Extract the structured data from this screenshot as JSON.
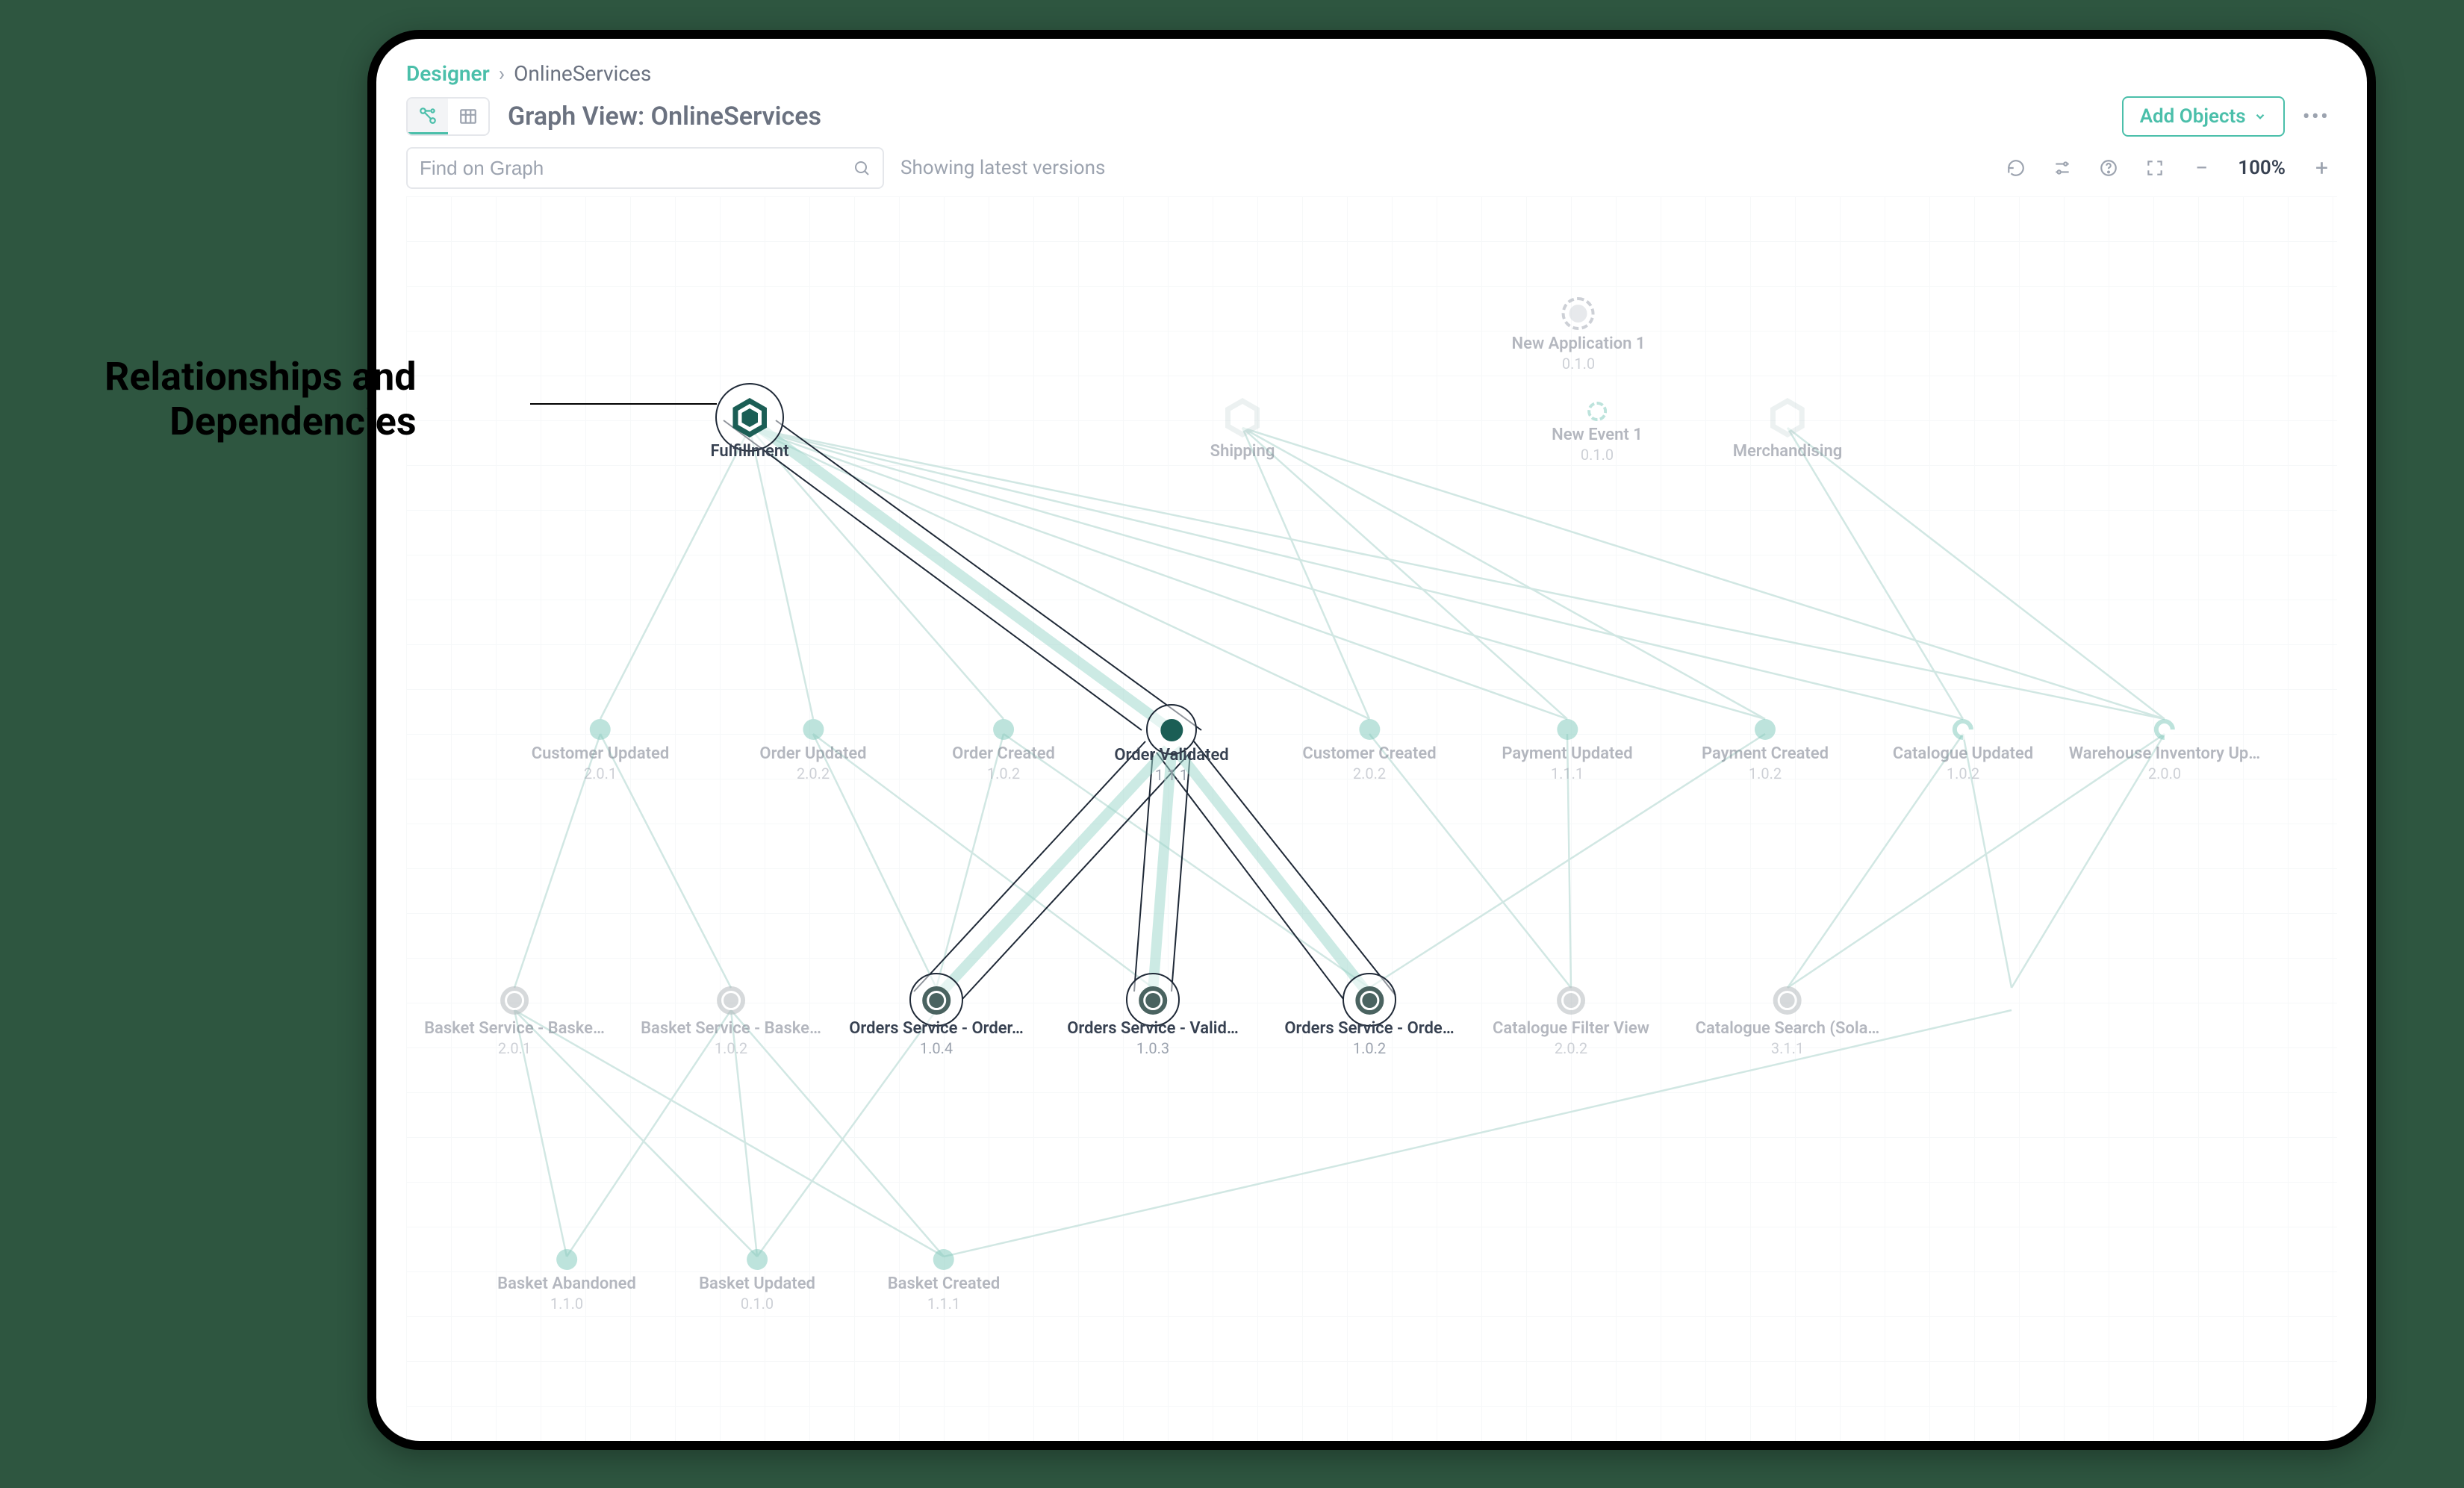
{
  "annotation": {
    "line1": "Relationships and",
    "line2": "Dependencies"
  },
  "breadcrumb": {
    "root": "Designer",
    "current": "OnlineServices"
  },
  "title": "Graph View: OnlineServices",
  "buttons": {
    "add_objects": "Add Objects"
  },
  "search": {
    "placeholder": "Find on Graph"
  },
  "status": "Showing latest versions",
  "zoom": "100%",
  "nodes": {
    "fulfillment": {
      "label": "Fulfillment",
      "version": ""
    },
    "shipping": {
      "label": "Shipping",
      "version": ""
    },
    "merchandising": {
      "label": "Merchandising",
      "version": ""
    },
    "new_app": {
      "label": "New Application 1",
      "version": "0.1.0"
    },
    "new_event": {
      "label": "New Event 1",
      "version": "0.1.0"
    },
    "customer_updated": {
      "label": "Customer Updated",
      "version": "2.0.1"
    },
    "order_updated": {
      "label": "Order Updated",
      "version": "2.0.2"
    },
    "order_created": {
      "label": "Order Created",
      "version": "1.0.2"
    },
    "order_validated": {
      "label": "Order Validated",
      "version": "1.1.1"
    },
    "customer_created": {
      "label": "Customer Created",
      "version": "2.0.2"
    },
    "payment_updated": {
      "label": "Payment Updated",
      "version": "1.1.1"
    },
    "payment_created": {
      "label": "Payment Created",
      "version": "1.0.2"
    },
    "catalogue_updated": {
      "label": "Catalogue Updated",
      "version": "1.0.2"
    },
    "warehouse_inv": {
      "label": "Warehouse Inventory Up…",
      "version": "2.0.0"
    },
    "basket_svc_1": {
      "label": "Basket Service - Baske…",
      "version": "2.0.1"
    },
    "basket_svc_2": {
      "label": "Basket Service - Baske…",
      "version": "1.0.2"
    },
    "orders_svc_1": {
      "label": "Orders Service - Order…",
      "version": "1.0.4"
    },
    "orders_svc_2": {
      "label": "Orders Service - Valid…",
      "version": "1.0.3"
    },
    "orders_svc_3": {
      "label": "Orders Service - Orde…",
      "version": "1.0.2"
    },
    "catalogue_filter": {
      "label": "Catalogue Filter View",
      "version": "2.0.2"
    },
    "catalogue_search": {
      "label": "Catalogue Search (Sola…",
      "version": "3.1.1"
    },
    "basket_abandoned": {
      "label": "Basket Abandoned",
      "version": "1.1.0"
    },
    "basket_updated": {
      "label": "Basket Updated",
      "version": "0.1.0"
    },
    "basket_created": {
      "label": "Basket Created",
      "version": "1.1.1"
    }
  }
}
